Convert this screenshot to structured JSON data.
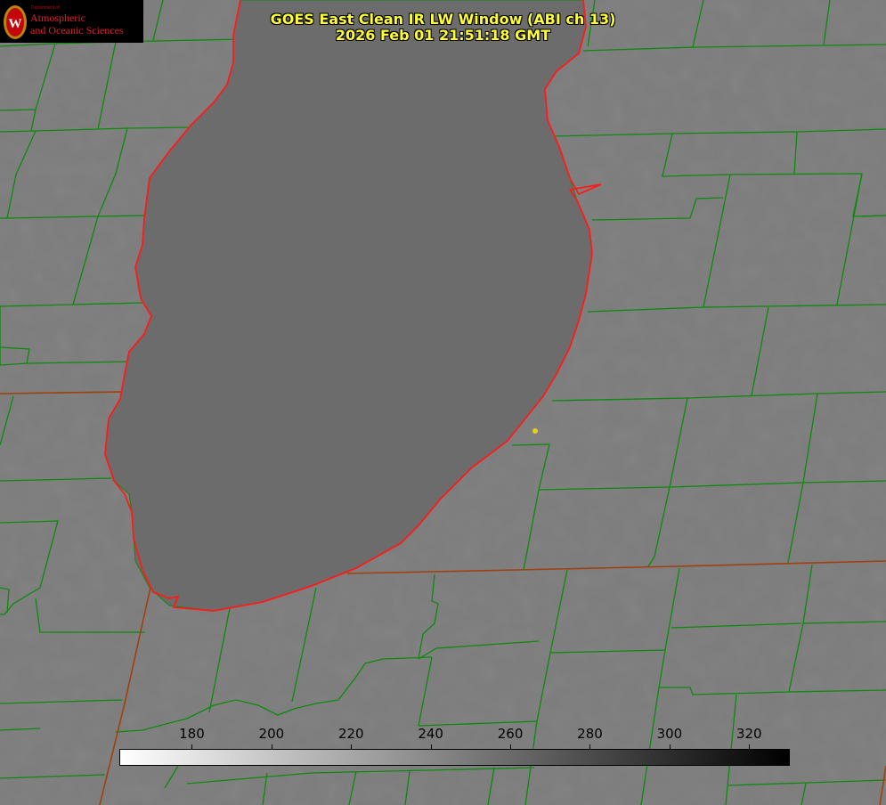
{
  "title": {
    "line1": "GOES East Clean IR LW Window (ABI ch 13)",
    "line2": "2026 Feb 01 21:51:18 GMT"
  },
  "logo": {
    "department": "Department of",
    "line1": "Atmospheric",
    "line2": "and Oceanic Sciences",
    "crest_letter": "W"
  },
  "colorbar": {
    "min": 162,
    "max": 330,
    "ticks": [
      "180",
      "200",
      "220",
      "240",
      "260",
      "280",
      "300",
      "320"
    ],
    "tick_values": [
      180,
      200,
      220,
      240,
      260,
      280,
      300,
      320
    ],
    "start_color": "#ffffff",
    "end_color": "#000000"
  },
  "colors": {
    "background": "#7d7d7d",
    "lake": "#6c6c6c",
    "county_lines": "#0d8a0d",
    "state_lines": "#a04010",
    "coastline": "#ff1a1a",
    "title_text": "#ffff33",
    "marker": "#e6d21a"
  },
  "map": {
    "feature": "lake",
    "marker": "point"
  }
}
